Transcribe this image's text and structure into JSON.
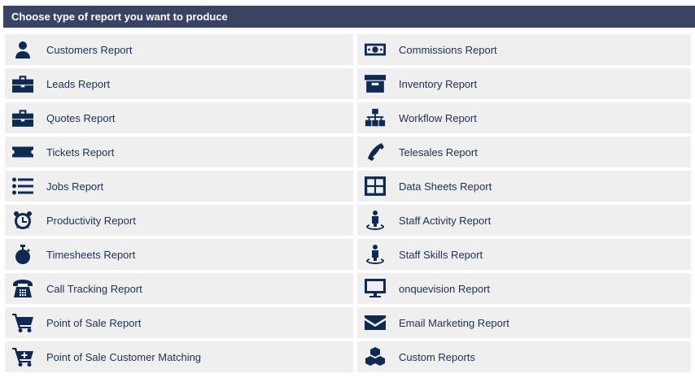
{
  "header": {
    "title": "Choose type of report you want to produce"
  },
  "colors": {
    "header_bg": "#3a4462",
    "item_bg": "#efefef",
    "icon": "#0e2a53",
    "text": "#1e2f55"
  },
  "left": [
    {
      "label": "Customers Report",
      "icon": "user-icon"
    },
    {
      "label": "Leads Report",
      "icon": "briefcase-icon"
    },
    {
      "label": "Quotes Report",
      "icon": "briefcase-icon"
    },
    {
      "label": "Tickets Report",
      "icon": "ticket-icon"
    },
    {
      "label": "Jobs Report",
      "icon": "list-icon"
    },
    {
      "label": "Productivity Report",
      "icon": "alarm-clock-icon"
    },
    {
      "label": "Timesheets Report",
      "icon": "stopwatch-icon"
    },
    {
      "label": "Call Tracking Report",
      "icon": "rotary-phone-icon"
    },
    {
      "label": "Point of Sale Report",
      "icon": "shopping-cart-icon"
    },
    {
      "label": "Point of Sale Customer Matching",
      "icon": "cart-plus-icon"
    }
  ],
  "right": [
    {
      "label": "Commissions Report",
      "icon": "money-icon"
    },
    {
      "label": "Inventory Report",
      "icon": "archive-icon"
    },
    {
      "label": "Workflow Report",
      "icon": "sitemap-icon"
    },
    {
      "label": "Telesales Report",
      "icon": "phone-icon"
    },
    {
      "label": "Data Sheets Report",
      "icon": "table-icon"
    },
    {
      "label": "Staff Activity Report",
      "icon": "person-pin-icon"
    },
    {
      "label": "Staff Skills Report",
      "icon": "person-pin-icon"
    },
    {
      "label": "onquevision Report",
      "icon": "monitor-icon"
    },
    {
      "label": "Email Marketing Report",
      "icon": "envelope-icon"
    },
    {
      "label": "Custom Reports",
      "icon": "cubes-icon"
    }
  ]
}
